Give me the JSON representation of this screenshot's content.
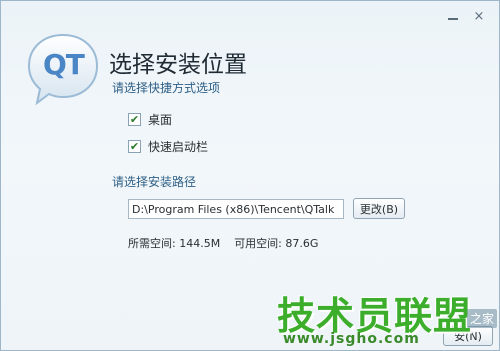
{
  "window": {
    "minimize_icon": "minimize-icon",
    "close_label": "×"
  },
  "logo": {
    "text": "QT"
  },
  "header": {
    "title": "选择安装位置",
    "subtitle": "请选择快捷方式选项"
  },
  "shortcuts": [
    {
      "label": "桌面",
      "checked": true
    },
    {
      "label": "快速启动栏",
      "checked": true
    }
  ],
  "install_path": {
    "label": "请选择安装路径",
    "value": "D:\\Program Files (x86)\\Tencent\\QTalk",
    "change_label": "更改(B)"
  },
  "space": {
    "required": "所需空间: 144.5M",
    "available": "可用空间: 87.6G"
  },
  "footer": {
    "next_label": "安(N)"
  },
  "watermark": {
    "brand": "技术员联盟",
    "url": "www.jsgho.com",
    "extra": "之家"
  },
  "colors": {
    "accent": "#4a86c6",
    "watermark": "#3cae2c"
  }
}
